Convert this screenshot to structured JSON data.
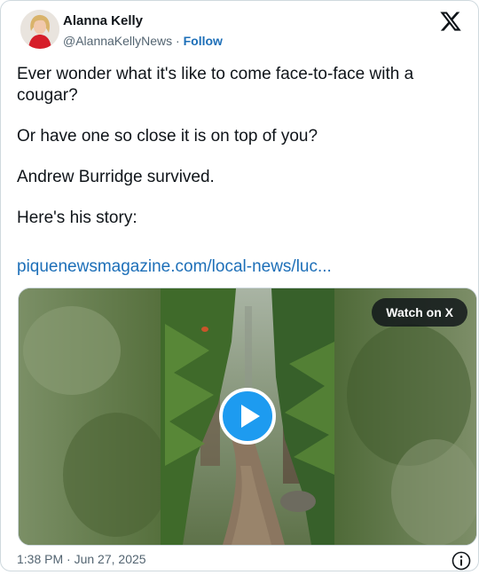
{
  "author": {
    "name": "Alanna Kelly",
    "handle": "@AlannaKellyNews",
    "separator": "·",
    "follow_label": "Follow"
  },
  "icons": {
    "brand": "x-logo-icon",
    "avatar": "avatar-image",
    "play": "play-icon",
    "info": "info-icon"
  },
  "tweet": {
    "paragraphs": [
      "Ever wonder what it's like to come face-to-face with a cougar?",
      "Or have one so close it is on top of you?",
      "Andrew Burridge survived.",
      "Here's his story:"
    ],
    "link_text": "piquenewsmagazine.com/local-news/luc..."
  },
  "media": {
    "watch_label": "Watch on X",
    "play_color": "#1d9bf0"
  },
  "footer": {
    "time": "1:38 PM",
    "separator": "·",
    "date": "Jun 27, 2025"
  },
  "colors": {
    "link": "#1d6fb8",
    "muted": "#536471",
    "text": "#0f1419"
  }
}
